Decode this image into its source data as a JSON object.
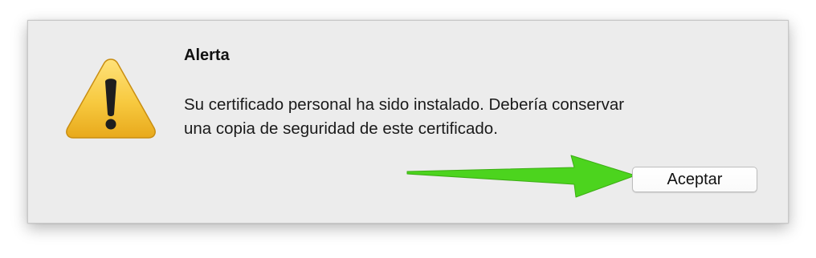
{
  "dialog": {
    "title": "Alerta",
    "message_line_1": "Su certificado personal ha sido instalado. Debería conservar",
    "message_line_2": "una copia de seguridad de este certificado.",
    "accept_label": "Aceptar"
  },
  "icons": {
    "alert": "warning-icon",
    "annotation": "arrow-icon"
  },
  "colors": {
    "dialog_background": "#ececec",
    "warning_yellow": "#f5c23a",
    "arrow_green": "#4cd41e"
  }
}
